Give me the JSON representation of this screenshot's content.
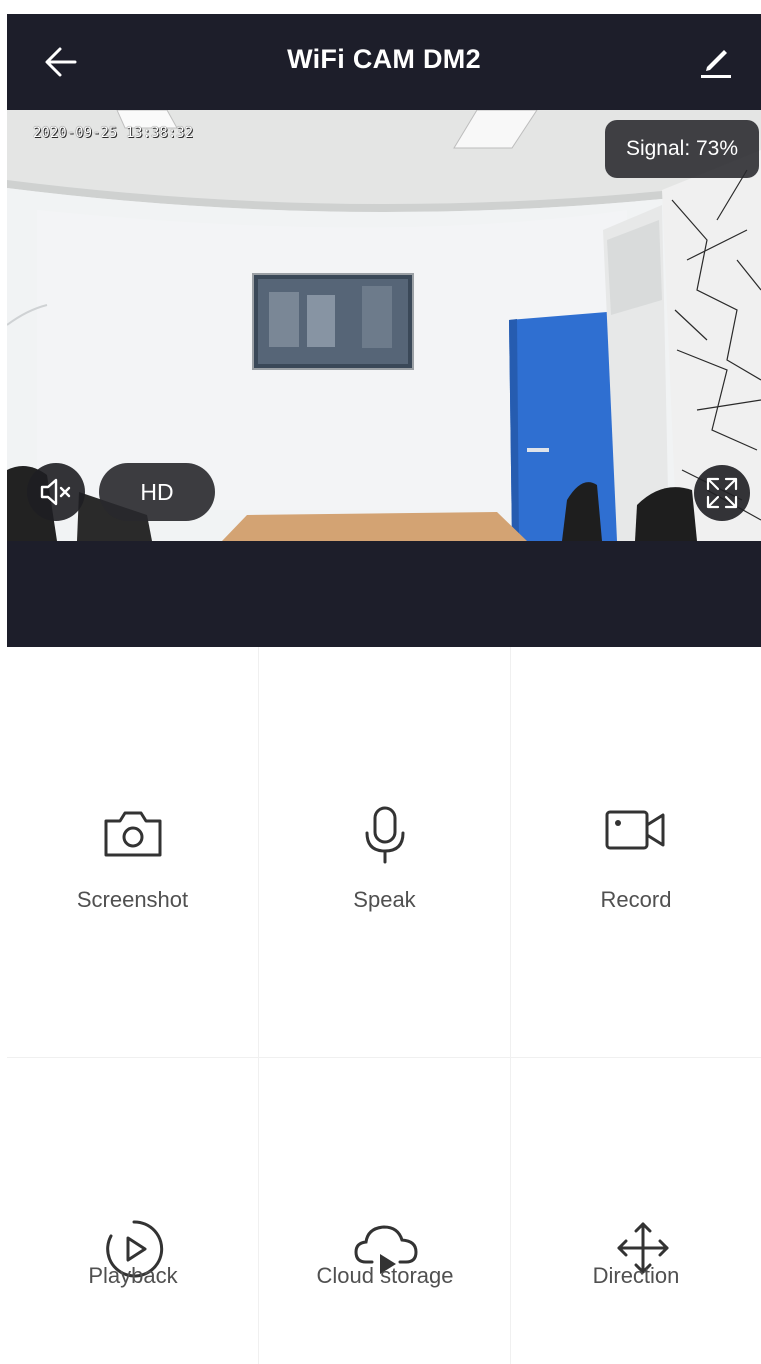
{
  "header": {
    "title": "WiFi CAM DM2",
    "back_icon": "arrow-left-icon",
    "edit_icon": "pencil-icon"
  },
  "video": {
    "timestamp": "2020-09-25 13:38:32",
    "signal_text": "Signal: 73%",
    "quality_label": "HD",
    "mute_icon": "speaker-mute-icon",
    "fullscreen_icon": "fullscreen-icon"
  },
  "controls": [
    {
      "label": "Screenshot",
      "icon": "camera-icon"
    },
    {
      "label": "Speak",
      "icon": "microphone-icon"
    },
    {
      "label": "Record",
      "icon": "video-camera-icon"
    },
    {
      "label": "Playback",
      "icon": "playback-icon"
    },
    {
      "label": "Cloud storage",
      "icon": "cloud-play-icon"
    },
    {
      "label": "Direction",
      "icon": "move-arrows-icon"
    }
  ],
  "colors": {
    "header_bg": "#1d1e2a",
    "icon": "#333333",
    "label": "#505050"
  }
}
